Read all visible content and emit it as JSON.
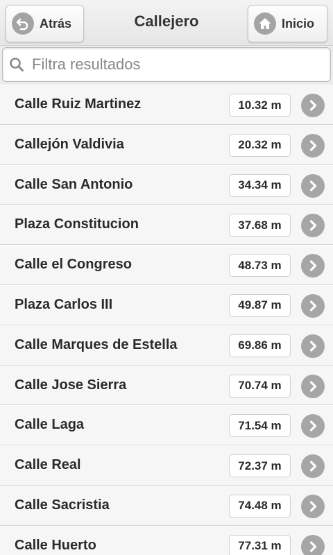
{
  "header": {
    "title": "Callejero",
    "back_label": "Atrás",
    "home_label": "Inicio",
    "back_icon": "back-arrow-icon",
    "home_icon": "home-icon"
  },
  "search": {
    "placeholder": "Filtra resultados",
    "value": "",
    "icon": "search-icon"
  },
  "colors": {
    "icon_circle": "#a6a6a6",
    "text": "#2a2a2a",
    "row_bg": "#f6f6f6"
  },
  "streets": [
    {
      "name": "Calle Ruiz Martinez",
      "distance": "10.32 m"
    },
    {
      "name": "Callejón Valdivia",
      "distance": "20.32 m"
    },
    {
      "name": "Calle San Antonio",
      "distance": "34.34 m"
    },
    {
      "name": "Plaza Constitucion",
      "distance": "37.68 m"
    },
    {
      "name": "Calle el Congreso",
      "distance": "48.73 m"
    },
    {
      "name": "Plaza Carlos III",
      "distance": "49.87 m"
    },
    {
      "name": "Calle Marques de Estella",
      "distance": "69.86 m"
    },
    {
      "name": "Calle Jose Sierra",
      "distance": "70.74 m"
    },
    {
      "name": "Calle Laga",
      "distance": "71.54 m"
    },
    {
      "name": "Calle Real",
      "distance": "72.37 m"
    },
    {
      "name": "Calle Sacristia",
      "distance": "74.48 m"
    },
    {
      "name": "Calle Huerto",
      "distance": "77.31 m"
    }
  ]
}
